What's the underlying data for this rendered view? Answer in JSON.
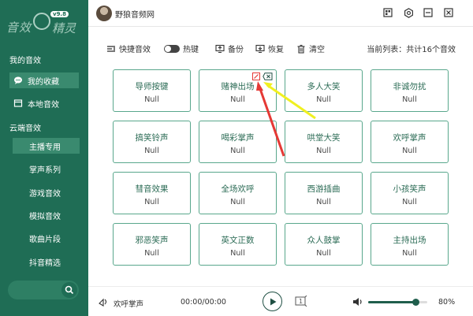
{
  "app": {
    "title": "野狼音频网",
    "logo_left": "音效",
    "logo_right": "精灵",
    "version": "v9.8"
  },
  "sidebar": {
    "my_heading": "我的音效",
    "my_items": [
      {
        "label": "我的收藏",
        "icon": "chat-bubble-icon",
        "active": true
      },
      {
        "label": "本地音效",
        "icon": "folder-icon",
        "active": false
      }
    ],
    "cloud_heading": "云端音效",
    "cloud_items": [
      {
        "label": "主播专用",
        "active": true
      },
      {
        "label": "掌声系列"
      },
      {
        "label": "游戏音效"
      },
      {
        "label": "模拟音效"
      },
      {
        "label": "歌曲片段"
      },
      {
        "label": "抖音精选"
      }
    ]
  },
  "toolbar": {
    "shortcut_label": "快捷音效",
    "hotkey_label": "热键",
    "backup_label": "备份",
    "restore_label": "恢复",
    "clear_label": "清空",
    "list_info": "当前列表：共计16个音效"
  },
  "cards": [
    {
      "name": "导师按键",
      "value": "Null"
    },
    {
      "name": "赌神出场",
      "value": "Null",
      "hovered": true
    },
    {
      "name": "多人大笑",
      "value": "Null"
    },
    {
      "name": "非诚勿扰",
      "value": "Null"
    },
    {
      "name": "搞笑铃声",
      "value": "Null"
    },
    {
      "name": "喝彩掌声",
      "value": "Null"
    },
    {
      "name": "哄堂大笑",
      "value": "Null"
    },
    {
      "name": "欢呼掌声",
      "value": "Null"
    },
    {
      "name": "彗音效果",
      "value": "Null"
    },
    {
      "name": "全场欢呼",
      "value": "Null"
    },
    {
      "name": "西游插曲",
      "value": "Null"
    },
    {
      "name": "小孩笑声",
      "value": "Null"
    },
    {
      "name": "邪恶笑声",
      "value": "Null"
    },
    {
      "name": "英文正数",
      "value": "Null"
    },
    {
      "name": "众人鼓掌",
      "value": "Null"
    },
    {
      "name": "主持出场",
      "value": "Null"
    }
  ],
  "player": {
    "track_name": "欢呼掌声",
    "time": "00:00/00:00",
    "volume_pct_label": "80%",
    "volume": 0.8
  },
  "colors": {
    "sidebar": "#1f6d55",
    "accent": "#59a78c",
    "annotation_arrow": "#e53935",
    "annotation_highlight": "#f0f020"
  }
}
